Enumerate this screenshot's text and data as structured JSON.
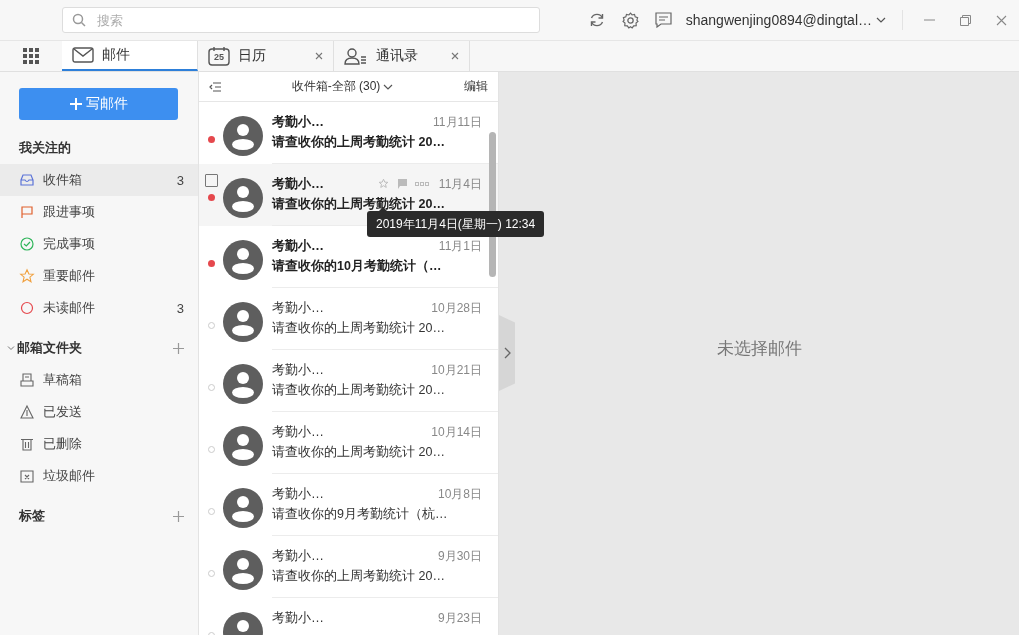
{
  "search": {
    "placeholder": "搜索"
  },
  "account": {
    "name": "shangwenjing0894@dingtal…"
  },
  "tabs": [
    {
      "label": "邮件",
      "kind": "mail",
      "selected": true,
      "closable": false
    },
    {
      "label": "日历",
      "kind": "calendar",
      "selected": false,
      "closable": true,
      "badge": "25"
    },
    {
      "label": "通讯录",
      "kind": "contacts",
      "selected": false,
      "closable": true
    }
  ],
  "sidebar": {
    "compose": "写邮件",
    "favorites": {
      "title": "我关注的",
      "items": [
        {
          "label": "收件箱",
          "kind": "inbox",
          "count": "3",
          "selected": true
        },
        {
          "label": "跟进事项",
          "kind": "flag",
          "selected": false
        },
        {
          "label": "完成事项",
          "kind": "done",
          "selected": false
        },
        {
          "label": "重要邮件",
          "kind": "star",
          "selected": false
        },
        {
          "label": "未读邮件",
          "kind": "unread",
          "count": "3",
          "selected": false
        }
      ]
    },
    "folders": {
      "title": "邮箱文件夹",
      "expanded": true,
      "items": [
        {
          "label": "草稿箱",
          "kind": "drafts",
          "selected": false
        },
        {
          "label": "已发送",
          "kind": "sent",
          "selected": false
        },
        {
          "label": "已删除",
          "kind": "deleted",
          "selected": false
        },
        {
          "label": "垃圾邮件",
          "kind": "spam",
          "selected": false
        }
      ]
    },
    "tags": {
      "title": "标签"
    }
  },
  "list": {
    "title": "收件箱-全部 (30)",
    "edit": "编辑",
    "rows": [
      {
        "sender": "考勤小…",
        "subject": "请查收你的上周考勤统计 20…",
        "date": "11月11日",
        "unread": true,
        "hovered": false
      },
      {
        "sender": "考勤小…",
        "subject": "请查收你的上周考勤统计 20…",
        "date": "11月4日",
        "unread": true,
        "hovered": true,
        "tooltip": "2019年11月4日(星期一) 12:34"
      },
      {
        "sender": "考勤小…",
        "subject": "请查收你的10月考勤统计（…",
        "date": "11月1日",
        "unread": true,
        "hovered": false
      },
      {
        "sender": "考勤小…",
        "subject": "请查收你的上周考勤统计 20…",
        "date": "10月28日",
        "unread": false,
        "hovered": false
      },
      {
        "sender": "考勤小…",
        "subject": "请查收你的上周考勤统计 20…",
        "date": "10月21日",
        "unread": false,
        "hovered": false
      },
      {
        "sender": "考勤小…",
        "subject": "请查收你的上周考勤统计 20…",
        "date": "10月14日",
        "unread": false,
        "hovered": false
      },
      {
        "sender": "考勤小…",
        "subject": "请查收你的9月考勤统计（杭…",
        "date": "10月8日",
        "unread": false,
        "hovered": false
      },
      {
        "sender": "考勤小…",
        "subject": "请查收你的上周考勤统计 20…",
        "date": "9月30日",
        "unread": false,
        "hovered": false
      },
      {
        "sender": "考勤小…",
        "date": "9月23日",
        "unread": false,
        "hovered": false
      }
    ]
  },
  "reader": {
    "empty": "未选择邮件"
  }
}
